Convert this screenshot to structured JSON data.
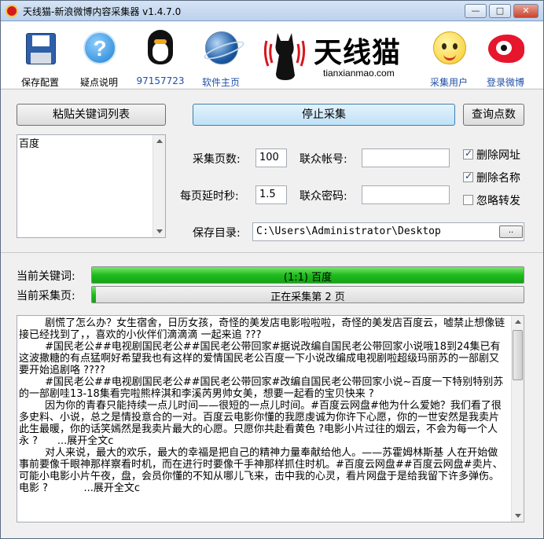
{
  "window": {
    "title": "天线猫-新浪微博内容采集器 v1.4.7.0",
    "minimize_label": "—",
    "maximize_label": "□",
    "close_label": "✕"
  },
  "toolbar": {
    "items": [
      {
        "label": "保存配置",
        "icon": "floppy-disk-icon"
      },
      {
        "label": "疑点说明",
        "icon": "help-icon"
      },
      {
        "label": "97157723",
        "icon": "qq-penguin-icon"
      },
      {
        "label": "软件主页",
        "icon": "globe-icon"
      },
      {
        "label": "采集用户",
        "icon": "smiley-icon"
      },
      {
        "label": "登录微博",
        "icon": "weibo-icon"
      }
    ],
    "logo": {
      "cn": "天线猫",
      "en": "tianxianmao.com"
    }
  },
  "controls": {
    "paste_keywords_label": "粘贴关键词列表",
    "stop_collect_label": "停止采集",
    "query_points_label": "查询点数",
    "keyword_list": "百度",
    "pages_label": "采集页数:",
    "pages_value": "100",
    "union_account_label": "联众帐号:",
    "union_account_value": "",
    "delay_label": "每页延时秒:",
    "delay_value": "1.5",
    "union_password_label": "联众密码:",
    "union_password_value": "",
    "save_dir_label": "保存目录:",
    "save_dir_value": "C:\\Users\\Administrator\\Desktop",
    "browse_label": "..",
    "checkboxes": [
      {
        "label": "删除网址",
        "checked": true
      },
      {
        "label": "删除名称",
        "checked": true
      },
      {
        "label": "忽略转发",
        "checked": false
      }
    ]
  },
  "status": {
    "keyword_label": "当前关键词:",
    "keyword_text": "(1:1) 百度",
    "keyword_progress": 1.0,
    "page_label": "当前采集页:",
    "page_text": "正在采集第 2 页",
    "page_progress": 0.01
  },
  "output": {
    "text": "        剧慌了怎么办？女生宿舍，日历女孩，奇怪的美发店电影啦啦啦，奇怪的美发店百度云，嘘禁止想像链接已经找到了，，喜欢的小伙伴们滴滴滴 一起来追 ???\n        #国民老公##电视剧国民老公##国民老公带回家#据说改编自国民老公带回家小说哦18到24集已有这波撒糖的有点猛啊好希望我也有这样的爱情国民老公百度一下小说改编成电视剧啦超级玛丽苏的一部剧又要开始追剧咯 ????\n        #国民老公##电视剧国民老公##国民老公带回家#改编自国民老公带回家小说~百度一下特别特别苏的一部剧哇13-18集看完啦熊梓淇和李溪芮男帅女美，想要一起看的宝贝快来 ?\n        因为你的青春只能持续一点儿时间——很短的一点儿时间。#百度云网盘#他为什么爱她？我们看了很多史料、小说，总之是情投意合的一对。百度云电影你懂的我愿虔诚为你许下心愿，你的一世安然是我卖片此生最暖，你的话笑嫣然是我卖片最大的心愿。只愿你共赴看黄色 ?电影小片过往的烟云，不会为每一个人永 ?      ...展开全文c\n        对人来说，最大的欢乐，最大的幸福是把自己的精神力量奉献给他人。——苏霍姆林斯基 人在开始做事前要像千眼神那样察看时机，而在进行时要像千手神那样抓住时机。#百度云网盘##百度云网盘#卖片、可能小电影小片午夜，盘，会员你懂的不知从哪儿飞来，击中我的心灵，看片网盘于是给我留下许多弹伤。电影 ?           ...展开全文c"
  },
  "colors": {
    "progress_green": "#1fbb1f",
    "primary_button": "#bfe1f7",
    "weibo_red": "#e6162d"
  }
}
